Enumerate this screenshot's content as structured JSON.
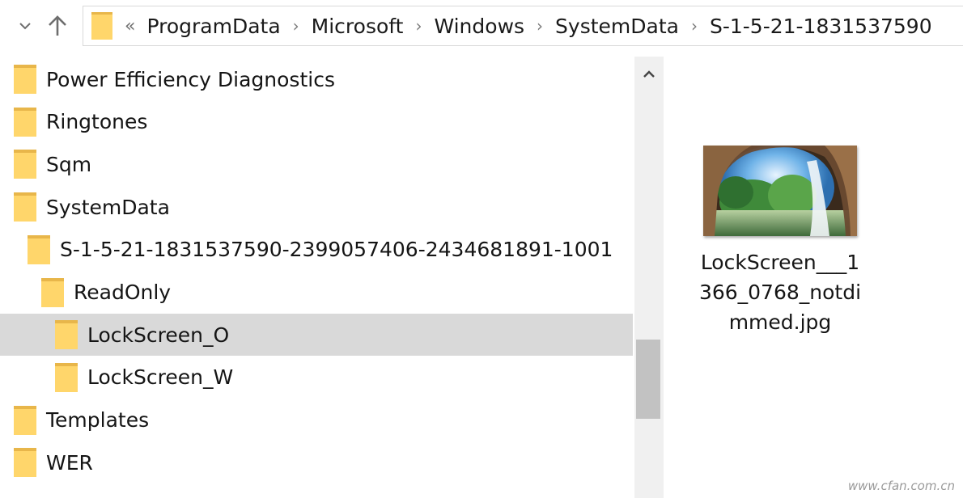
{
  "colors": {
    "folder_fill": "#ffd66b",
    "folder_back": "#e8b64a",
    "selection": "#d9d9d9",
    "scrollbar_track": "#f0f0f0",
    "scrollbar_thumb": "#c2c2c2"
  },
  "nav": {
    "recent_icon": "chevron-down-icon",
    "up_icon": "arrow-up-icon"
  },
  "address_bar": {
    "overflow": "«",
    "breadcrumbs": [
      "ProgramData",
      "Microsoft",
      "Windows",
      "SystemData",
      "S-1-5-21-1831537590"
    ]
  },
  "tree": {
    "items": [
      {
        "label": "Power Efficiency Diagnostics",
        "level": 0,
        "selected": false
      },
      {
        "label": "Ringtones",
        "level": 0,
        "selected": false
      },
      {
        "label": "Sqm",
        "level": 0,
        "selected": false
      },
      {
        "label": "SystemData",
        "level": 0,
        "selected": false
      },
      {
        "label": "S-1-5-21-1831537590-2399057406-2434681891-1001",
        "level": 1,
        "selected": false
      },
      {
        "label": "ReadOnly",
        "level": 2,
        "selected": false
      },
      {
        "label": "LockScreen_O",
        "level": 3,
        "selected": true
      },
      {
        "label": "LockScreen_W",
        "level": 3,
        "selected": false
      },
      {
        "label": "Templates",
        "level": 0,
        "selected": false
      },
      {
        "label": "WER",
        "level": 0,
        "selected": false
      }
    ]
  },
  "content": {
    "file": {
      "name": "LockScreen___1366_0768_notdimmed.jpg",
      "thumbnail": "waterfall-cave-thumbnail"
    }
  },
  "watermark": "www.cfan.com.cn"
}
